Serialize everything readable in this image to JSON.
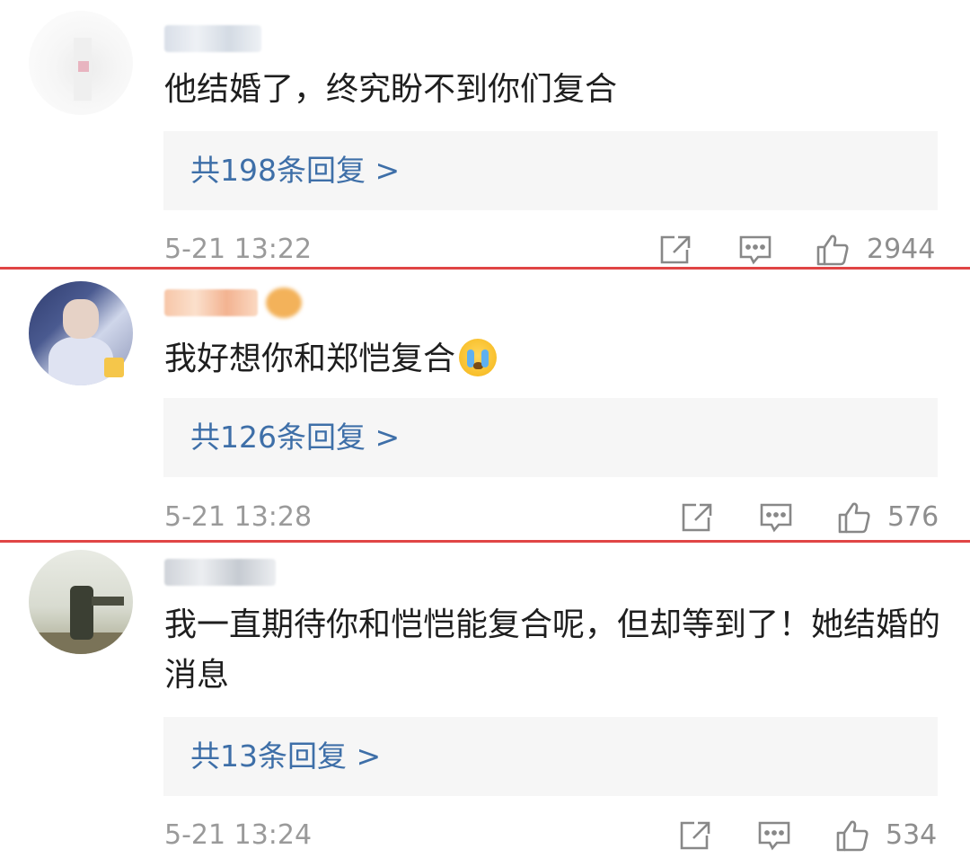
{
  "comments": [
    {
      "text": "他结婚了，终究盼不到你们复合",
      "replies": "共198条回复 >",
      "time": "5-21 13:22",
      "likes": "2944"
    },
    {
      "text": "我好想你和郑恺复合",
      "emoji": "crying-face-emoji",
      "replies": "共126条回复 >",
      "time": "5-21 13:28",
      "likes": "576"
    },
    {
      "text": "我一直期待你和恺恺能复合呢，但却等到了！她结婚的消息",
      "replies": "共13条回复 >",
      "time": "5-21 13:24",
      "likes": "534"
    }
  ],
  "icons": {
    "share": "share-icon",
    "comment": "comment-icon",
    "like": "thumbs-up-icon"
  },
  "colors": {
    "reply_link": "#3e6fa8",
    "divider": "#e04545",
    "reply_box_bg": "#f6f6f6",
    "meta_gray": "#9a9a9a"
  }
}
